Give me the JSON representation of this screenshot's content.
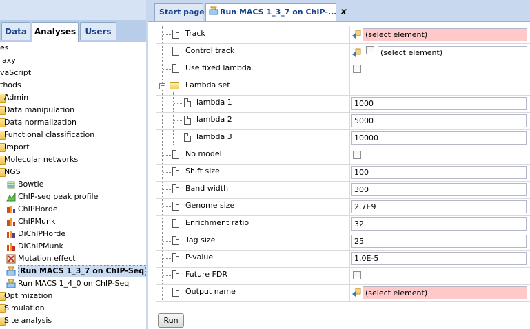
{
  "left_tabs": [
    {
      "label": "Data",
      "active": false
    },
    {
      "label": "Analyses",
      "active": true
    },
    {
      "label": "Users",
      "active": false
    }
  ],
  "tree": [
    {
      "label": "es",
      "icon": "none",
      "selected": false
    },
    {
      "label": "laxy",
      "icon": "none",
      "selected": false
    },
    {
      "label": "vaScript",
      "icon": "none",
      "selected": false
    },
    {
      "label": "thods",
      "icon": "none",
      "selected": false
    },
    {
      "label": "Admin",
      "icon": "folder-icon",
      "selected": false
    },
    {
      "label": "Data manipulation",
      "icon": "folder-icon",
      "selected": false
    },
    {
      "label": "Data normalization",
      "icon": "folder-icon",
      "selected": false
    },
    {
      "label": "Functional classification",
      "icon": "folder-icon",
      "selected": false
    },
    {
      "label": "Import",
      "icon": "folder-icon",
      "selected": false
    },
    {
      "label": "Molecular networks",
      "icon": "folder-icon",
      "selected": false
    },
    {
      "label": "NGS",
      "icon": "folder-icon",
      "selected": false
    },
    {
      "label": "Bowtie",
      "icon": "bowtie-icon",
      "selected": false
    },
    {
      "label": "ChIP-seq peak profile",
      "icon": "peak-profile-icon",
      "selected": false
    },
    {
      "label": "ChIPHorde",
      "icon": "chiphorde-icon",
      "selected": false
    },
    {
      "label": "ChIPMunk",
      "icon": "chipmunk-icon",
      "selected": false
    },
    {
      "label": "DiChIPHorde",
      "icon": "dichiphorde-icon",
      "selected": false
    },
    {
      "label": "DiChIPMunk",
      "icon": "dichipmunk-icon",
      "selected": false
    },
    {
      "label": "Mutation effect",
      "icon": "mutation-icon",
      "selected": false
    },
    {
      "label": "Run MACS 1_3_7 on ChIP-Seq",
      "icon": "macs-icon",
      "selected": true
    },
    {
      "label": "Run MACS 1_4_0 on ChIP-Seq",
      "icon": "macs-icon",
      "selected": false
    },
    {
      "label": "Optimization",
      "icon": "folder-icon",
      "selected": false
    },
    {
      "label": "Simulation",
      "icon": "folder-icon",
      "selected": false
    },
    {
      "label": "Site analysis",
      "icon": "folder-icon",
      "selected": false
    }
  ],
  "right_tabs": [
    {
      "label": "Start page",
      "active": false
    },
    {
      "label": "Run MACS 1_3_7 on ChIP-...",
      "active": true
    }
  ],
  "form": {
    "track": {
      "label": "Track",
      "value": "(select element)"
    },
    "control_track": {
      "label": "Control track",
      "value": "(select element)"
    },
    "use_fixed_lambda": {
      "label": "Use fixed lambda"
    },
    "lambda_set": {
      "label": "Lambda set"
    },
    "lambda1": {
      "label": "lambda 1",
      "value": "1000"
    },
    "lambda2": {
      "label": "lambda 2",
      "value": "5000"
    },
    "lambda3": {
      "label": "lambda 3",
      "value": "10000"
    },
    "no_model": {
      "label": "No model"
    },
    "shift_size": {
      "label": "Shift size",
      "value": "100"
    },
    "band_width": {
      "label": "Band width",
      "value": "300"
    },
    "genome_size": {
      "label": "Genome size",
      "value": "2.7E9"
    },
    "enrichment_ratio": {
      "label": "Enrichment ratio",
      "value": "32"
    },
    "tag_size": {
      "label": "Tag size",
      "value": "25"
    },
    "p_value": {
      "label": "P-value",
      "value": "1.0E-5"
    },
    "future_fdr": {
      "label": "Future FDR"
    },
    "output_name": {
      "label": "Output name",
      "value": "(select element)"
    }
  },
  "run_label": "Run",
  "colors": {
    "required_bg": "#ffc9c9",
    "selection_bg": "#c9dbf3",
    "tab_text": "#15428b"
  }
}
